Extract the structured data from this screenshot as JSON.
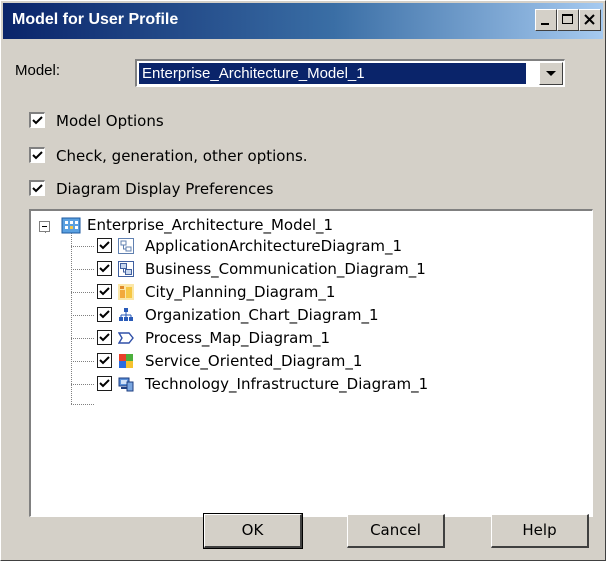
{
  "window": {
    "title": "Model for User Profile",
    "controls": [
      "minimize-icon",
      "maximize-icon",
      "close-icon"
    ]
  },
  "model": {
    "label": "Model:",
    "selected": "Enterprise_Architecture_Model_1"
  },
  "options": [
    {
      "label": "Model Options",
      "checked": true
    },
    {
      "label": "Check, generation, other options.",
      "checked": true
    },
    {
      "label": "Diagram Display Preferences",
      "checked": true
    }
  ],
  "tree": {
    "root": {
      "label": "Enterprise_Architecture_Model_1",
      "expanded": true,
      "icon": "enterprise-model-icon"
    },
    "items": [
      {
        "label": "ApplicationArchitectureDiagram_1",
        "checked": true,
        "icon": "application-architecture-diagram-icon"
      },
      {
        "label": "Business_Communication_Diagram_1",
        "checked": true,
        "icon": "business-communication-diagram-icon"
      },
      {
        "label": "City_Planning_Diagram_1",
        "checked": true,
        "icon": "city-planning-diagram-icon"
      },
      {
        "label": "Organization_Chart_Diagram_1",
        "checked": true,
        "icon": "organization-chart-diagram-icon"
      },
      {
        "label": "Process_Map_Diagram_1",
        "checked": true,
        "icon": "process-map-diagram-icon"
      },
      {
        "label": "Service_Oriented_Diagram_1",
        "checked": true,
        "icon": "service-oriented-diagram-icon"
      },
      {
        "label": "Technology_Infrastructure_Diagram_1",
        "checked": true,
        "icon": "technology-infrastructure-diagram-icon"
      }
    ]
  },
  "buttons": {
    "ok": "OK",
    "cancel": "Cancel",
    "help": "Help"
  },
  "colors": {
    "titlebar_start": "#0a246a",
    "titlebar_end": "#a6caf0",
    "selection": "#0a246a",
    "face": "#d4d0c8"
  }
}
